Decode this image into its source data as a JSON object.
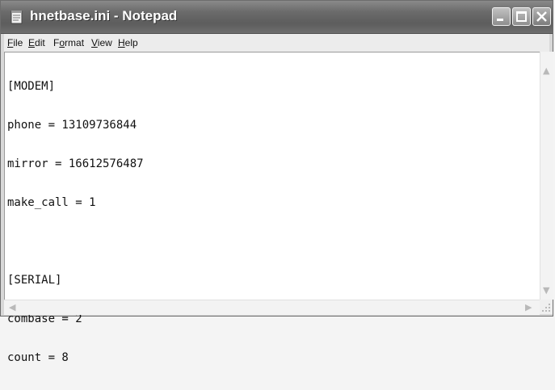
{
  "window": {
    "title": "hnetbase.ini - Notepad"
  },
  "menu": [
    {
      "key": "F",
      "rest": "ile"
    },
    {
      "key": "E",
      "rest": "dit"
    },
    {
      "pre": "F",
      "key": "o",
      "rest": "rmat"
    },
    {
      "key": "V",
      "rest": "iew"
    },
    {
      "key": "H",
      "rest": "elp"
    }
  ],
  "document": {
    "lines": [
      "[MODEM]",
      "phone = 13109736844",
      "mirror = 16612576487",
      "make_call = 1",
      "",
      "[SERIAL]",
      "combase = 2",
      "count = 8"
    ]
  },
  "icons": {
    "app": "notepad-icon",
    "minimize": "minimize-icon",
    "maximize": "maximize-icon",
    "close": "close-icon",
    "scroll_up": "scroll-up-icon",
    "scroll_down": "scroll-down-icon",
    "scroll_left": "scroll-left-icon",
    "scroll_right": "scroll-right-icon",
    "size_grip": "size-grip-icon"
  }
}
